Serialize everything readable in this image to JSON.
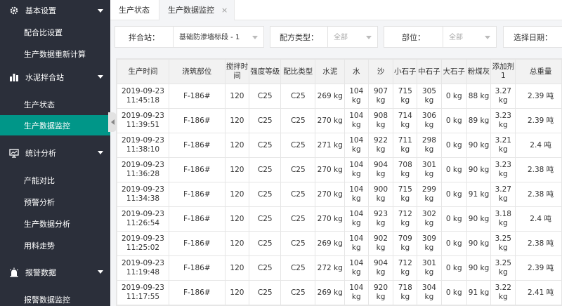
{
  "sidebar": {
    "groups": [
      {
        "label": "基本设置",
        "icon": "gear-icon"
      },
      {
        "label": "水泥拌合站",
        "icon": "bar-chart-icon"
      },
      {
        "label": "统计分析",
        "icon": "monitor-icon"
      },
      {
        "label": "报警数据",
        "icon": "alarm-icon"
      }
    ],
    "items": {
      "mix_ratio": "配合比设置",
      "recalc": "生产数据重新计算",
      "prod_status": "生产状态",
      "prod_monitor": "生产数据监控",
      "capacity": "产能对比",
      "warning": "预警分析",
      "prod_analysis": "生产数据分析",
      "material_trend": "用料走势",
      "alarm_monitor": "报警数据监控"
    }
  },
  "tabs": {
    "tab1": "生产状态",
    "tab2": "生产数据监控",
    "close": "×"
  },
  "filters": {
    "station_label": "拌合站：",
    "station_value": "基础防渗墙标段 - 1",
    "recipe_label": "配方类型：",
    "recipe_value": "全部",
    "part_label": "部位：",
    "part_value": "全部",
    "date_label": "选择日期："
  },
  "table": {
    "headers": [
      "生产时间",
      "浇筑部位",
      "搅拌时间",
      "强度等级",
      "配比类型",
      "水泥",
      "水",
      "沙",
      "小石子",
      "中石子",
      "大石子",
      "粉煤灰",
      "添加剂1",
      "总重量"
    ],
    "rows": [
      [
        "2019-09-23 11:45:18",
        "F-186#",
        "120",
        "C25",
        "C25",
        "269 kg",
        "104 kg",
        "907 kg",
        "715 kg",
        "305 kg",
        "0 kg",
        "88 kg",
        "3.27 kg",
        "2.39 吨"
      ],
      [
        "2019-09-23 11:39:51",
        "F-186#",
        "120",
        "C25",
        "C25",
        "270 kg",
        "104 kg",
        "908 kg",
        "714 kg",
        "306 kg",
        "0 kg",
        "89 kg",
        "3.23 kg",
        "2.39 吨"
      ],
      [
        "2019-09-23 11:38:10",
        "F-186#",
        "120",
        "C25",
        "C25",
        "271 kg",
        "104 kg",
        "922 kg",
        "711 kg",
        "298 kg",
        "0 kg",
        "90 kg",
        "3.21 kg",
        "2.4 吨"
      ],
      [
        "2019-09-23 11:36:28",
        "F-186#",
        "120",
        "C25",
        "C25",
        "270 kg",
        "104 kg",
        "904 kg",
        "708 kg",
        "301 kg",
        "0 kg",
        "90 kg",
        "3.23 kg",
        "2.38 吨"
      ],
      [
        "2019-09-23 11:34:38",
        "F-186#",
        "120",
        "C25",
        "C25",
        "270 kg",
        "104 kg",
        "900 kg",
        "715 kg",
        "299 kg",
        "0 kg",
        "91 kg",
        "3.27 kg",
        "2.38 吨"
      ],
      [
        "2019-09-23 11:26:54",
        "F-186#",
        "120",
        "C25",
        "C25",
        "270 kg",
        "104 kg",
        "923 kg",
        "712 kg",
        "302 kg",
        "0 kg",
        "90 kg",
        "3.18 kg",
        "2.4 吨"
      ],
      [
        "2019-09-23 11:25:02",
        "F-186#",
        "120",
        "C25",
        "C25",
        "269 kg",
        "104 kg",
        "902 kg",
        "709 kg",
        "309 kg",
        "0 kg",
        "90 kg",
        "3.25 kg",
        "2.38 吨"
      ],
      [
        "2019-09-23 11:19:48",
        "F-186#",
        "120",
        "C25",
        "C25",
        "272 kg",
        "104 kg",
        "904 kg",
        "712 kg",
        "301 kg",
        "0 kg",
        "90 kg",
        "3.25 kg",
        "2.39 吨"
      ],
      [
        "2019-09-23 11:17:55",
        "F-186#",
        "120",
        "C25",
        "C25",
        "269 kg",
        "104 kg",
        "920 kg",
        "718 kg",
        "304 kg",
        "0 kg",
        "91 kg",
        "3.22 kg",
        "2.41 吨"
      ]
    ]
  },
  "colors": {
    "sidebar_bg": "#2b2f3a",
    "accent": "#009688"
  }
}
